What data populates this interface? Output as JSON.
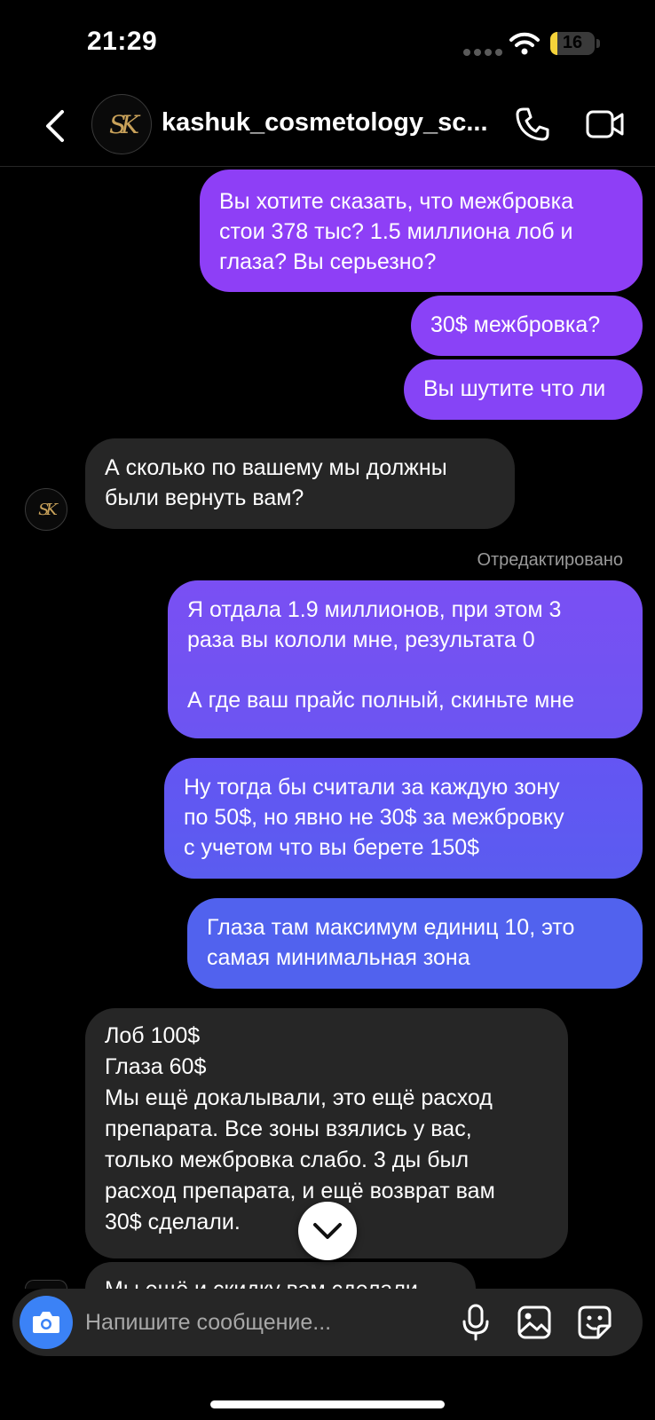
{
  "status_bar": {
    "time": "21:29",
    "battery_level": "16",
    "battery_fraction": 0.16
  },
  "header": {
    "contact_name": "kashuk_cosmetology_sc...",
    "avatar_monogram": "SK"
  },
  "colors": {
    "sent_gradient_top": "#a23fff",
    "sent_gradient_bottom": "#4c5cf0",
    "received_bubble": "#262626",
    "camera_button": "#3b82f6"
  },
  "messages": [
    {
      "direction": "sent",
      "text": "Вы хотите сказать, что межбровка\nстои 378 тыс? 1.5 миллиона лоб и\nглаза? Вы серьезно?"
    },
    {
      "direction": "sent",
      "text": "30$ межбровка?"
    },
    {
      "direction": "sent",
      "text": "Вы шутите что ли"
    },
    {
      "direction": "received",
      "text": "А сколько по вашему мы должны\nбыли вернуть вам?"
    },
    {
      "direction": "sent",
      "text": "Я отдала 1.9 миллионов, при этом 3\nраза вы кололи мне, результата 0\n\nА где ваш прайс полный, скиньте мне",
      "edited_label": "Отредактировано"
    },
    {
      "direction": "sent",
      "text": "Ну тогда бы считали за каждую зону\nпо 50$, но явно не 30$ за межбровку\nс учетом что вы берете 150$"
    },
    {
      "direction": "sent",
      "text": "Глаза там максимум единиц 10, это\nсамая минимальная зона"
    },
    {
      "direction": "received",
      "text": "Лоб 100$\nГлаза 60$\nМы ещё докалывали, это ещё расход\nпрепарата. Все зоны взялись у вас,\nтолько межбровка слабо. 3 ды был\nрасход препарата, и ещё возврат вам\n30$ сделали."
    },
    {
      "direction": "received",
      "text": "Мы ещё и скидку вам сделали"
    }
  ],
  "composer": {
    "placeholder": "Напишите сообщение..."
  },
  "icons": {
    "back": "chevron-left-icon",
    "call": "phone-icon",
    "video": "video-camera-icon",
    "camera": "camera-icon",
    "mic": "microphone-icon",
    "gallery": "image-icon",
    "sticker": "sticker-icon",
    "scroll_down": "chevron-down-icon"
  }
}
